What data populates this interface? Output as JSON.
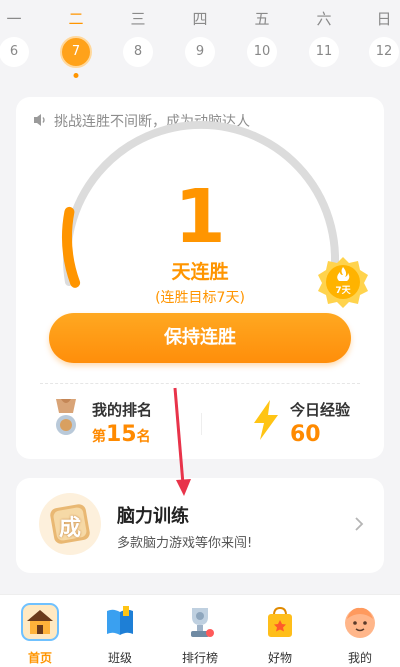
{
  "week": {
    "days": [
      "一",
      "二",
      "三",
      "四",
      "五",
      "六",
      "日"
    ],
    "dates": [
      "6",
      "7",
      "8",
      "9",
      "10",
      "11",
      "12"
    ],
    "active_index": 1
  },
  "streak_card": {
    "tip": "挑战连胜不间断，成为动脑达人",
    "streak_days": "1",
    "streak_label": "天连胜",
    "goal_text": "(连胜目标7天)",
    "badge_text": "7天",
    "keep_button": "保持连胜",
    "progress_fraction": 0.14,
    "rank": {
      "title": "我的排名",
      "prefix": "第",
      "value": "15",
      "suffix": "名"
    },
    "exp": {
      "title": "今日经验",
      "value": "60"
    }
  },
  "training": {
    "title": "脑力训练",
    "subtitle": "多款脑力游戏等你来闯!",
    "icon_char": "成"
  },
  "tabs": [
    {
      "label": "首页",
      "icon": "home-icon"
    },
    {
      "label": "班级",
      "icon": "book-icon"
    },
    {
      "label": "排行榜",
      "icon": "trophy-icon"
    },
    {
      "label": "好物",
      "icon": "shopping-bag-icon"
    },
    {
      "label": "我的",
      "icon": "avatar-icon"
    }
  ],
  "colors": {
    "accent": "#ff9500",
    "gauge_track": "#dcdcdc"
  }
}
